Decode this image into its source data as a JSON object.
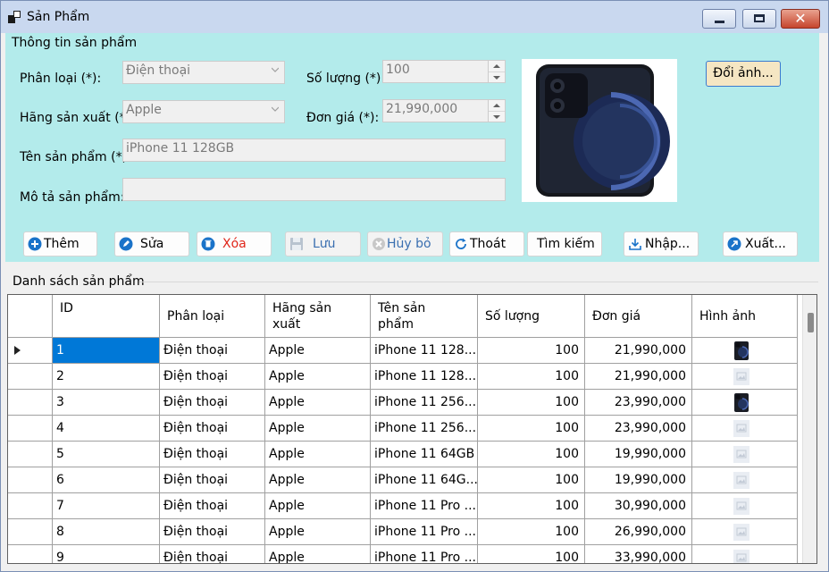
{
  "window": {
    "title": "Sản Phẩm",
    "close_glyph": "✕"
  },
  "info": {
    "group_title": "Thông tin sản phẩm",
    "category": {
      "label": "Phân loại (*):",
      "value": "Điện thoại"
    },
    "quantity": {
      "label": "Số lượng (*):",
      "value": "100"
    },
    "manufacturer": {
      "label": "Hãng sản xuất (*):",
      "value": "Apple"
    },
    "price": {
      "label": "Đơn giá (*):",
      "value": "21,990,000"
    },
    "name": {
      "label": "Tên sản phẩm (*):",
      "value": "iPhone 11 128GB"
    },
    "description": {
      "label": "Mô tả sản phẩm:",
      "value": ""
    },
    "change_image_label": "Đổi ảnh..."
  },
  "toolbar": {
    "add": "Thêm",
    "edit": "Sửa",
    "delete": "Xóa",
    "save": "Lưu",
    "cancel": "Hủy bỏ",
    "exit": "Thoát",
    "search": "Tìm kiếm",
    "import": "Nhập...",
    "export": "Xuất..."
  },
  "colors": {
    "delete_text": "#e0261a",
    "disabled_text": "#3a6fb0",
    "selection": "#0078d7",
    "panel_bg": "#b3ebeb"
  },
  "list": {
    "title": "Danh sách sản phẩm",
    "columns": [
      "ID",
      "Phân loại",
      "Hãng sản xuất",
      "Tên sản phẩm",
      "Số lượng",
      "Đơn giá",
      "Hình ảnh"
    ],
    "rows": [
      {
        "id": "1",
        "category": "Điện thoại",
        "brand": "Apple",
        "name": "iPhone 11 128...",
        "qty": "100",
        "price": "21,990,000",
        "image": "phone-thumbnail-icon"
      },
      {
        "id": "2",
        "category": "Điện thoại",
        "brand": "Apple",
        "name": "iPhone 11 128...",
        "qty": "100",
        "price": "21,990,000",
        "image": "placeholder-image-icon"
      },
      {
        "id": "3",
        "category": "Điện thoại",
        "brand": "Apple",
        "name": "iPhone 11 256...",
        "qty": "100",
        "price": "23,990,000",
        "image": "phone-thumbnail-icon"
      },
      {
        "id": "4",
        "category": "Điện thoại",
        "brand": "Apple",
        "name": "iPhone 11 256...",
        "qty": "100",
        "price": "23,990,000",
        "image": "placeholder-image-icon"
      },
      {
        "id": "5",
        "category": "Điện thoại",
        "brand": "Apple",
        "name": "iPhone 11 64GB",
        "qty": "100",
        "price": "19,990,000",
        "image": "placeholder-image-icon"
      },
      {
        "id": "6",
        "category": "Điện thoại",
        "brand": "Apple",
        "name": "iPhone 11 64G...",
        "qty": "100",
        "price": "19,990,000",
        "image": "placeholder-image-icon"
      },
      {
        "id": "7",
        "category": "Điện thoại",
        "brand": "Apple",
        "name": "iPhone 11 Pro ...",
        "qty": "100",
        "price": "30,990,000",
        "image": "placeholder-image-icon"
      },
      {
        "id": "8",
        "category": "Điện thoại",
        "brand": "Apple",
        "name": "iPhone 11 Pro ...",
        "qty": "100",
        "price": "26,990,000",
        "image": "placeholder-image-icon"
      },
      {
        "id": "9",
        "category": "Điện thoại",
        "brand": "Apple",
        "name": "iPhone 11 Pro ...",
        "qty": "100",
        "price": "33,990,000",
        "image": "placeholder-image-icon"
      }
    ]
  }
}
